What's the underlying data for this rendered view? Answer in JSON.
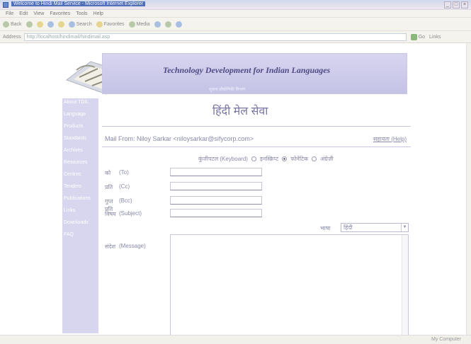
{
  "window": {
    "title": "Welcome to Hindi Mail Service - Microsoft Internet Explorer",
    "controls": [
      "_",
      "□",
      "×"
    ]
  },
  "menu": [
    "File",
    "Edit",
    "View",
    "Favorites",
    "Tools",
    "Help"
  ],
  "toolbar": {
    "back": "Back",
    "search": "Search",
    "favorites": "Favorites",
    "media": "Media"
  },
  "address": {
    "label": "Address",
    "url": "http://localhost/hindimail/hindimail.asp",
    "go": "Go",
    "links": "Links"
  },
  "banner": {
    "title": "Technology Development for Indian Languages",
    "subtitle": "सूचना प्रौद्योगिकी विभाग"
  },
  "sidebar": {
    "items": [
      {
        "label": "About TDIL"
      },
      {
        "label": "Language"
      },
      {
        "label": "Products"
      },
      {
        "label": "Standards"
      },
      {
        "label": "Archives"
      },
      {
        "label": "Resources"
      },
      {
        "label": "Centres"
      },
      {
        "label": "Tenders"
      },
      {
        "label": "Publications"
      },
      {
        "label": "Links"
      },
      {
        "label": "Downloads"
      },
      {
        "label": "FAQ"
      }
    ]
  },
  "page": {
    "heading": "हिंदी मेल सेवा",
    "mail_from": "Mail From: Niloy Sarkar <niloysarkar@sifycorp.com>",
    "help": "सहायता (Help)"
  },
  "keyboard": {
    "prefix": "कुंजीपटल (Keyboard)",
    "options": [
      {
        "label": "इनस्क्रिप्ट",
        "selected": false
      },
      {
        "label": "फोनेटिक",
        "selected": true
      },
      {
        "label": "अंग्रेज़ी",
        "selected": false
      }
    ]
  },
  "form": {
    "to": {
      "label": "को",
      "sub": "(To)"
    },
    "cc": {
      "label": "प्रति",
      "sub": "(Cc)"
    },
    "bcc": {
      "label": "गुप्त प्रति",
      "sub": "(Bcc)"
    },
    "subject": {
      "label": "विषय",
      "sub": "(Subject)"
    },
    "language_label": "भाषा",
    "language_value": "हिंदी",
    "message": {
      "label": "संदेश",
      "sub": "(Message)"
    }
  },
  "status": {
    "zone": "My Computer"
  }
}
